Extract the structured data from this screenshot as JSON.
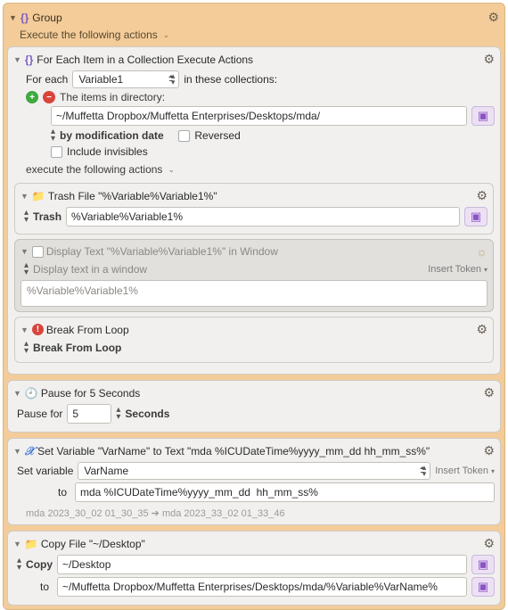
{
  "group": {
    "title": "Group",
    "subtitle": "Execute the following actions"
  },
  "foreach": {
    "title": "For Each Item in a Collection Execute Actions",
    "for_each_label": "For each",
    "variable": "Variable1",
    "in_these": "in these collections:",
    "items_in_dir": "The items in directory:",
    "path": "~/Muffetta Dropbox/Muffetta Enterprises/Desktops/mda/",
    "by_mod": "by modification date",
    "reversed": "Reversed",
    "include_inv": "Include invisibles",
    "exec_label": "execute the following actions"
  },
  "trash": {
    "title": "Trash File \"%Variable%Variable1%\"",
    "mode": "Trash",
    "path": "%Variable%Variable1%"
  },
  "display": {
    "title": "Display Text \"%Variable%Variable1%\" in Window",
    "mode": "Display text in a window",
    "insert_token": "Insert Token",
    "body": "%Variable%Variable1%"
  },
  "break": {
    "title": "Break From Loop",
    "mode": "Break From Loop"
  },
  "pause": {
    "title": "Pause for 5 Seconds",
    "label": "Pause for",
    "value": "5",
    "unit": "Seconds"
  },
  "setvar": {
    "title": "Set Variable \"VarName\" to Text \"mda %ICUDateTime%yyyy_mm_dd  hh_mm_ss%\"",
    "set_label": "Set variable",
    "varname": "VarName",
    "to_label": "to",
    "value": "mda %ICUDateTime%yyyy_mm_dd  hh_mm_ss%",
    "insert_token": "Insert Token",
    "preview": "mda 2023_30_02  01_30_35 ➔ mda 2023_33_02  01_33_46"
  },
  "copy": {
    "title": "Copy File \"~/Desktop\"",
    "mode": "Copy",
    "src": "~/Desktop",
    "to_label": "to",
    "dest": "~/Muffetta Dropbox/Muffetta Enterprises/Desktops/mda/%Variable%VarName%"
  }
}
